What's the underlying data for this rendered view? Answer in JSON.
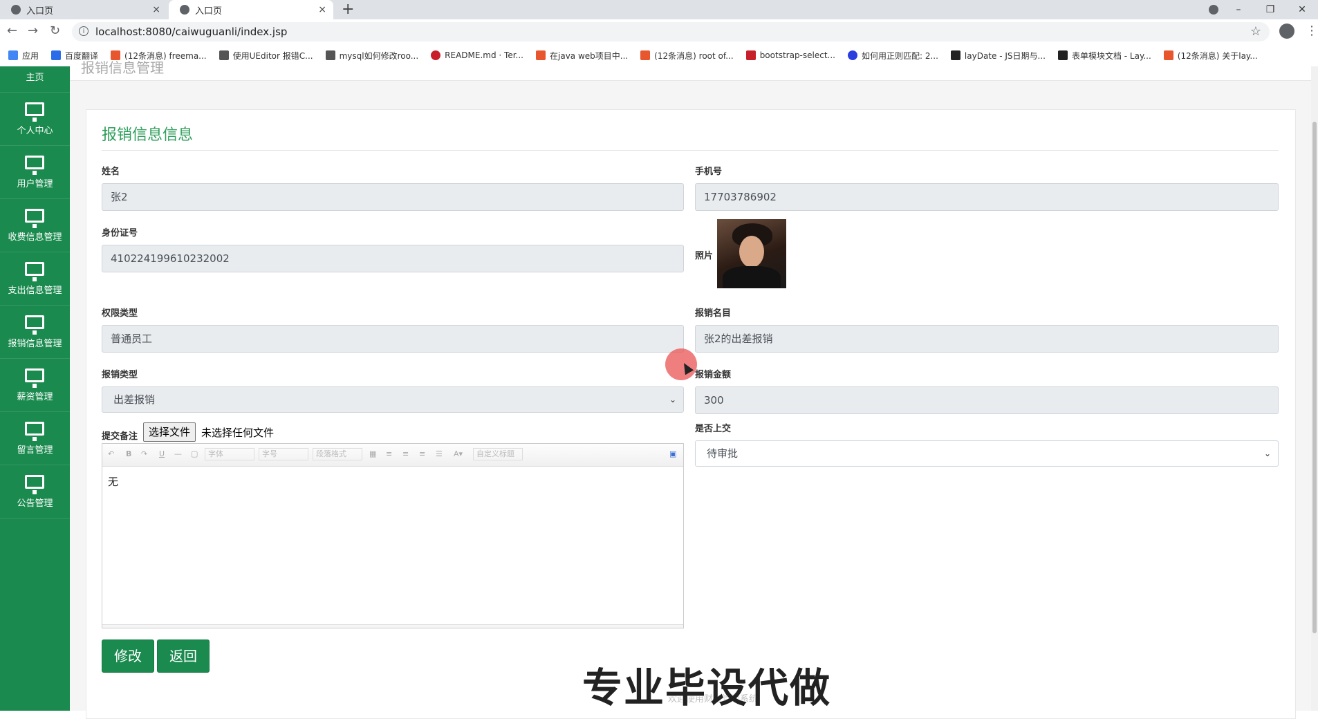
{
  "browser": {
    "tabs": [
      {
        "title": "入口页",
        "close": "×"
      },
      {
        "title": "入口页",
        "close": "×"
      }
    ],
    "new_tab": "+",
    "url": "localhost:8080/caiwuguanli/index.jsp",
    "bookmarks": [
      {
        "label": "应用",
        "color": "#4285f4"
      },
      {
        "label": "百度翻译",
        "color": "#2b6de8"
      },
      {
        "label": "(12条消息) freema...",
        "color": "#e8562e"
      },
      {
        "label": "使用UEditor 报错C...",
        "color": "#555555"
      },
      {
        "label": "mysql如何修改roo...",
        "color": "#555555"
      },
      {
        "label": "README.md · Ter...",
        "color": "#c7202b"
      },
      {
        "label": "在java web项目中...",
        "color": "#e8562e"
      },
      {
        "label": "(12条消息) root of...",
        "color": "#e8562e"
      },
      {
        "label": "bootstrap-select...",
        "color": "#c7202b"
      },
      {
        "label": "如何用正则匹配: 2...",
        "color": "#2b3fe0"
      },
      {
        "label": "layDate - JS日期与...",
        "color": "#222222"
      },
      {
        "label": "表单模块文档 - Lay...",
        "color": "#222222"
      },
      {
        "label": "(12条消息) 关于lay...",
        "color": "#e8562e"
      }
    ]
  },
  "sidebar": {
    "home": "主页",
    "items": [
      {
        "label": "个人中心"
      },
      {
        "label": "用户管理"
      },
      {
        "label": "收费信息管理"
      },
      {
        "label": "支出信息管理"
      },
      {
        "label": "报销信息管理"
      },
      {
        "label": "薪资管理"
      },
      {
        "label": "留言管理"
      },
      {
        "label": "公告管理"
      }
    ]
  },
  "page": {
    "crumb": "报销信息管理",
    "form_title": "报销信息信息"
  },
  "form": {
    "name_label": "姓名",
    "name_value": "张2",
    "phone_label": "手机号",
    "phone_value": "17703786902",
    "id_label": "身份证号",
    "id_value": "410224199610232002",
    "photo_label": "照片",
    "role_label": "权限类型",
    "role_value": "普通员工",
    "item_label": "报销名目",
    "item_value": "张2的出差报销",
    "type_label": "报销类型",
    "type_value": "出差报销",
    "amount_label": "报销金额",
    "amount_value": "300",
    "note_label": "提交备注",
    "file_button": "选择文件",
    "file_status": "未选择任何文件",
    "note_value": "无",
    "submitted_label": "是否上交",
    "submitted_value": "待审批"
  },
  "editor_toolbar": {
    "font_family": "字体",
    "font_size": "字号",
    "paragraph": "段落格式",
    "custom_title": "自定义标题"
  },
  "buttons": {
    "edit": "修改",
    "back": "返回"
  },
  "overlay": {
    "watermark": "专业毕设代做",
    "footer_partial": "欢迎使用财务管理系统"
  },
  "colors": {
    "sidebar": "#1a8a4e",
    "title_green": "#2e9e5b"
  }
}
